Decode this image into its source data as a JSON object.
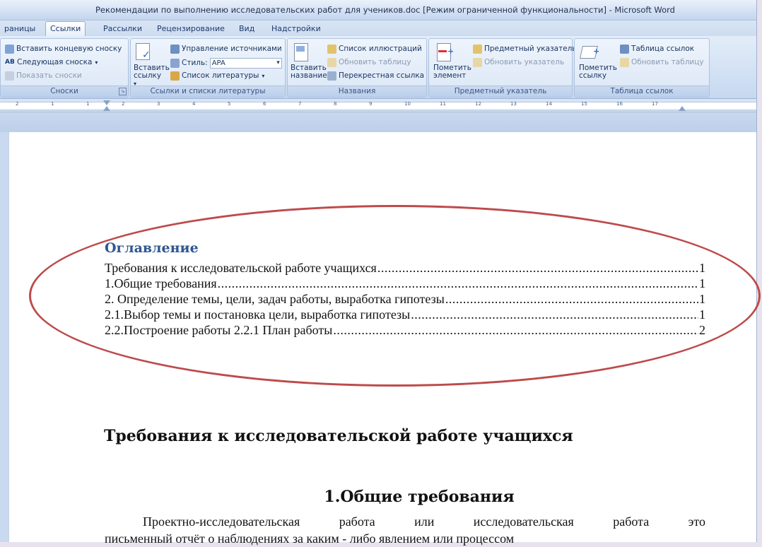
{
  "window": {
    "title": "Рекомендации по выполнению исследовательских работ для учеников.doc [Режим ограниченной функциональности] - Microsoft Word"
  },
  "tabs": [
    {
      "label": "раницы"
    },
    {
      "label": "Ссылки",
      "active": true
    },
    {
      "label": "Рассылки"
    },
    {
      "label": "Рецензирование"
    },
    {
      "label": "Вид"
    },
    {
      "label": "Надстройки"
    }
  ],
  "ribbon": {
    "footnotes": {
      "label": "Сноски",
      "insert_endnote": "Вставить концевую сноску",
      "next_footnote": "Следующая сноска",
      "show_notes": "Показать сноски"
    },
    "citations": {
      "label": "Ссылки и списки литературы",
      "insert_citation": "Вставить\nссылку",
      "manage_sources": "Управление источниками",
      "style_label": "Стиль:",
      "style_value": "APA",
      "bibliography": "Список литературы"
    },
    "captions": {
      "label": "Названия",
      "insert_caption": "Вставить\nназвание",
      "table_of_figures": "Список иллюстраций",
      "update_table": "Обновить таблицу",
      "cross_reference": "Перекрестная ссылка"
    },
    "index": {
      "label": "Предметный указатель",
      "mark_entry": "Пометить\nэлемент",
      "insert_index": "Предметный указатель",
      "update_index": "Обновить указатель"
    },
    "authorities": {
      "label": "Таблица ссылок",
      "mark_citation": "Пометить\nссылку",
      "insert_table": "Таблица ссылок",
      "update_table": "Обновить таблицу"
    }
  },
  "ruler": {
    "labels": [
      "2",
      "1",
      "1",
      "2",
      "3",
      "4",
      "5",
      "6",
      "7",
      "8",
      "9",
      "10",
      "11",
      "12",
      "13",
      "14",
      "15",
      "16",
      "17"
    ]
  },
  "document": {
    "toc_heading": "Оглавление",
    "toc_entries": [
      {
        "title": "Требования к исследовательской работе учащихся",
        "page": "1"
      },
      {
        "title": "1.Общие требования",
        "page": "1"
      },
      {
        "title": "2. Определение темы, цели, задач работы, выработка гипотезы",
        "page": "1"
      },
      {
        "title": "2.1.Выбор темы и постановка цели, выработка гипотезы",
        "page": "1"
      },
      {
        "title": "2.2.Построение работы 2.2.1 План работы",
        "page": "2"
      }
    ],
    "heading1": "Требования к исследовательской работе учащихся",
    "heading2": "1.Общие требования",
    "paragraph_line1": "Проектно-исследовательская работа или исследовательская работа это",
    "paragraph_line2": "письменный отчёт о наблюдениях за каким - либо явлением или процессом"
  },
  "colors": {
    "annotation_ellipse": "#bd4b4b",
    "toc_heading": "#2e5690"
  }
}
